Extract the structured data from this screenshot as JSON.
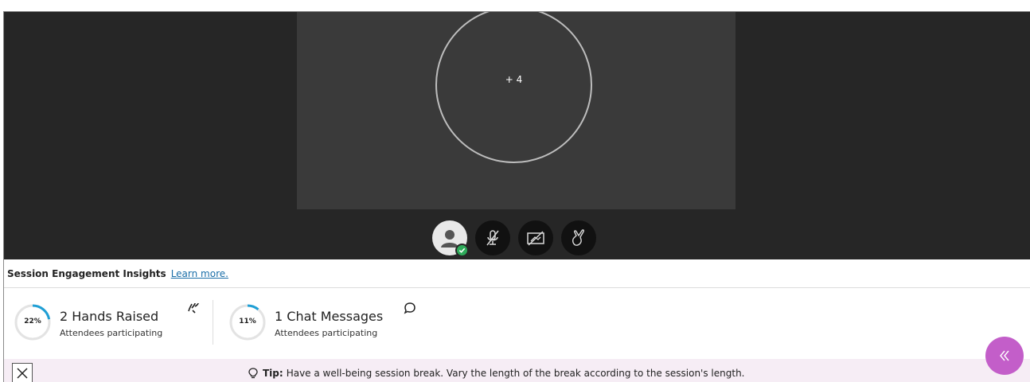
{
  "stage": {
    "overflow_label": "+ 4"
  },
  "controls": {
    "avatar_icon": "user-avatar-icon",
    "status_icon": "checkmark-icon",
    "mic_icon": "microphone-muted-icon",
    "camera_icon": "camera-off-icon",
    "hand_icon": "raise-hand-icon"
  },
  "insights": {
    "title": "Session Engagement Insights",
    "learn_more": "Learn more.",
    "metrics": [
      {
        "percent_label": "22%",
        "percent": 22,
        "title": "2 Hands Raised",
        "subtitle": "Attendees participating",
        "icon": "raised-hand-icon"
      },
      {
        "percent_label": "11%",
        "percent": 11,
        "title": "1 Chat Messages",
        "subtitle": "Attendees participating",
        "icon": "chat-bubble-icon"
      }
    ],
    "ring_color": "#1f9fd5"
  },
  "tip": {
    "label": "Tip:",
    "text": "Have a well-being session break. Vary the length of the break according to the session's length.",
    "icon": "lightbulb-icon"
  },
  "collapse_icon": "double-chevron-left-icon",
  "colors": {
    "stage_bg": "#262626",
    "accent": "#c35ec9",
    "status_green": "#2eab5a"
  }
}
